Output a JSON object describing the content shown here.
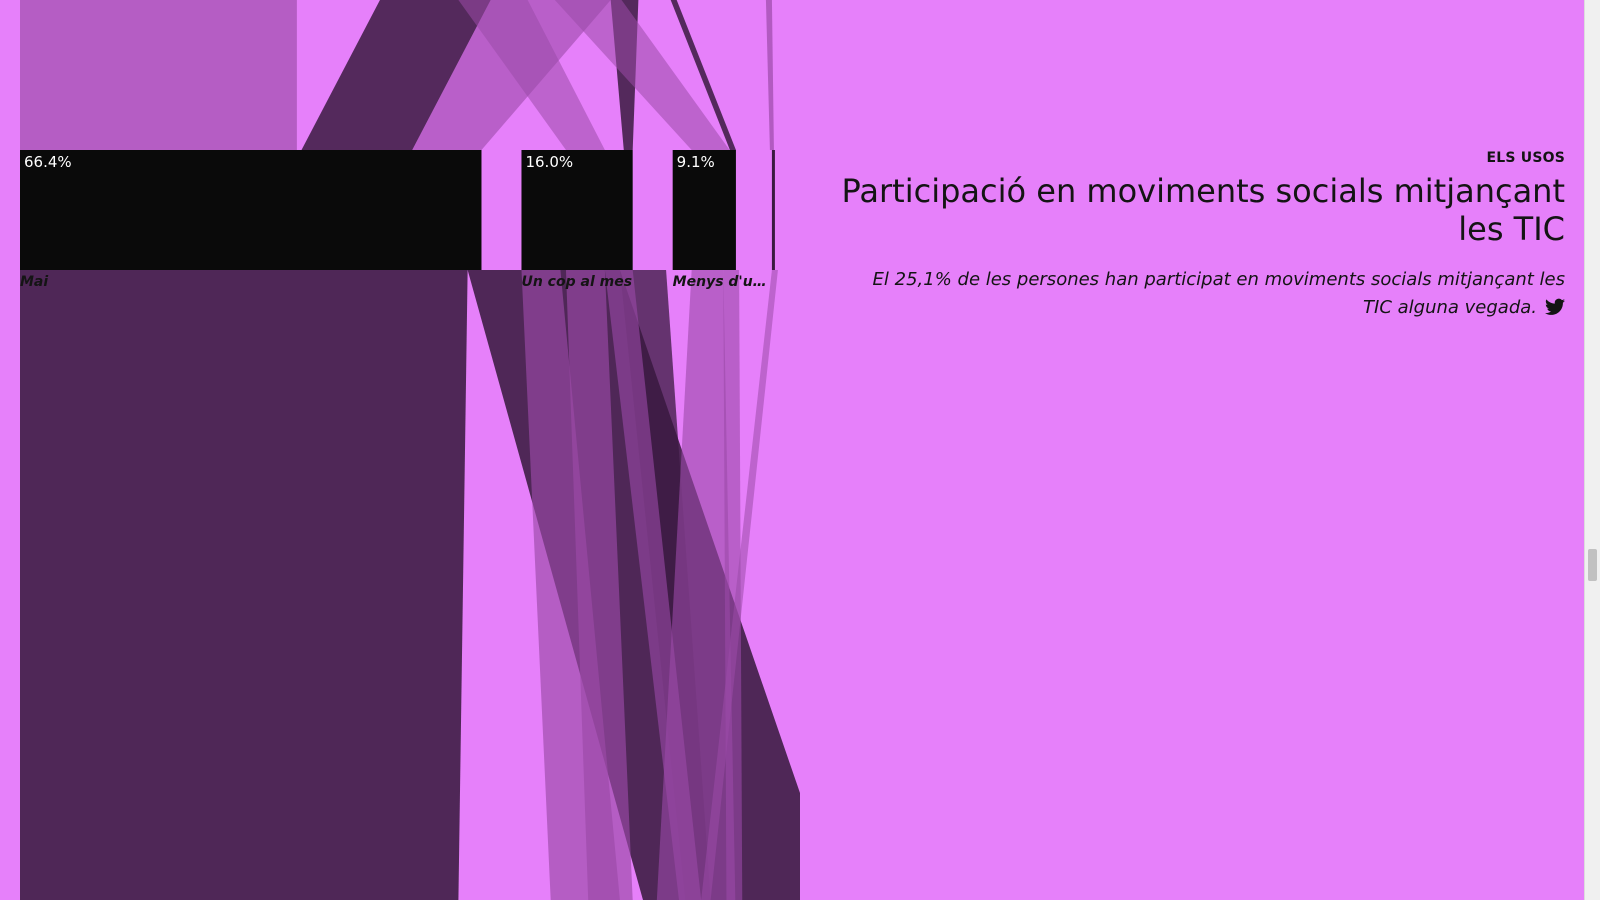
{
  "chart_data": {
    "type": "bar",
    "title": "",
    "categories": [
      "Mai",
      "Un cop al mes",
      "Menys d'u…"
    ],
    "values": [
      66.4,
      16.0,
      9.1
    ],
    "value_labels": [
      "66.4%",
      "16.0%",
      "9.1%"
    ],
    "units": "%",
    "visible_partial_remainder": true,
    "legend": "none",
    "grid": false
  },
  "panel": {
    "section_label": "ELS USOS",
    "headline": "Participació en moviments socials mitjançant les TIC",
    "summary": "El 25,1% de les persones han participat en moviments socials mitjançant les TIC alguna vegada."
  },
  "icons": {
    "share": "twitter-icon"
  },
  "colors": {
    "background": "#e680fa",
    "bar": "#0a0a0a",
    "flow_dark": "#3a1a40",
    "flow_light": "#9b4aa8",
    "text": "#141414"
  }
}
